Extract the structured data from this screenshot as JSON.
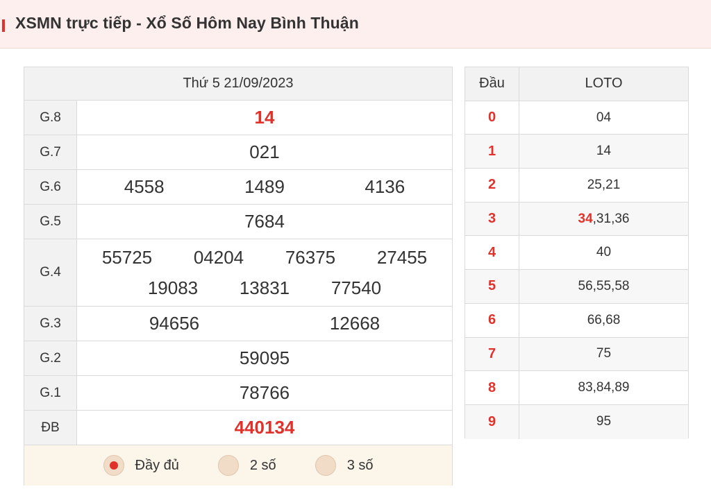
{
  "header": {
    "title": "XSMN trực tiếp - Xổ Số Hôm Nay Bình Thuận"
  },
  "results": {
    "date": "Thứ 5 21/09/2023",
    "prizes": [
      {
        "label": "G.8",
        "numbers": [
          "14"
        ]
      },
      {
        "label": "G.7",
        "numbers": [
          "021"
        ]
      },
      {
        "label": "G.6",
        "numbers": [
          "4558",
          "1489",
          "4136"
        ]
      },
      {
        "label": "G.5",
        "numbers": [
          "7684"
        ]
      },
      {
        "label": "G.4",
        "numbers": [
          "55725",
          "04204",
          "76375",
          "27455",
          "19083",
          "13831",
          "77540"
        ]
      },
      {
        "label": "G.3",
        "numbers": [
          "94656",
          "12668"
        ]
      },
      {
        "label": "G.2",
        "numbers": [
          "59095"
        ]
      },
      {
        "label": "G.1",
        "numbers": [
          "78766"
        ]
      },
      {
        "label": "ĐB",
        "numbers": [
          "440134"
        ]
      }
    ]
  },
  "modes": [
    {
      "label": "Đầy đủ",
      "checked": true
    },
    {
      "label": "2 số",
      "checked": false
    },
    {
      "label": "3 số",
      "checked": false
    }
  ],
  "loto": {
    "head_dau": "Đầu",
    "head_loto": "LOTO",
    "rows": [
      {
        "dau": "0",
        "highlight": "",
        "rest": "04"
      },
      {
        "dau": "1",
        "highlight": "",
        "rest": "14"
      },
      {
        "dau": "2",
        "highlight": "",
        "rest": "25,21"
      },
      {
        "dau": "3",
        "highlight": "34",
        "rest": ",31,36"
      },
      {
        "dau": "4",
        "highlight": "",
        "rest": "40"
      },
      {
        "dau": "5",
        "highlight": "",
        "rest": "56,55,58"
      },
      {
        "dau": "6",
        "highlight": "",
        "rest": "66,68"
      },
      {
        "dau": "7",
        "highlight": "",
        "rest": "75"
      },
      {
        "dau": "8",
        "highlight": "",
        "rest": "83,84,89"
      },
      {
        "dau": "9",
        "highlight": "",
        "rest": "95"
      }
    ]
  },
  "colors": {
    "accent": "#e0312a",
    "header_bg": "#fcefee",
    "modes_bg": "#fbf5ea"
  }
}
